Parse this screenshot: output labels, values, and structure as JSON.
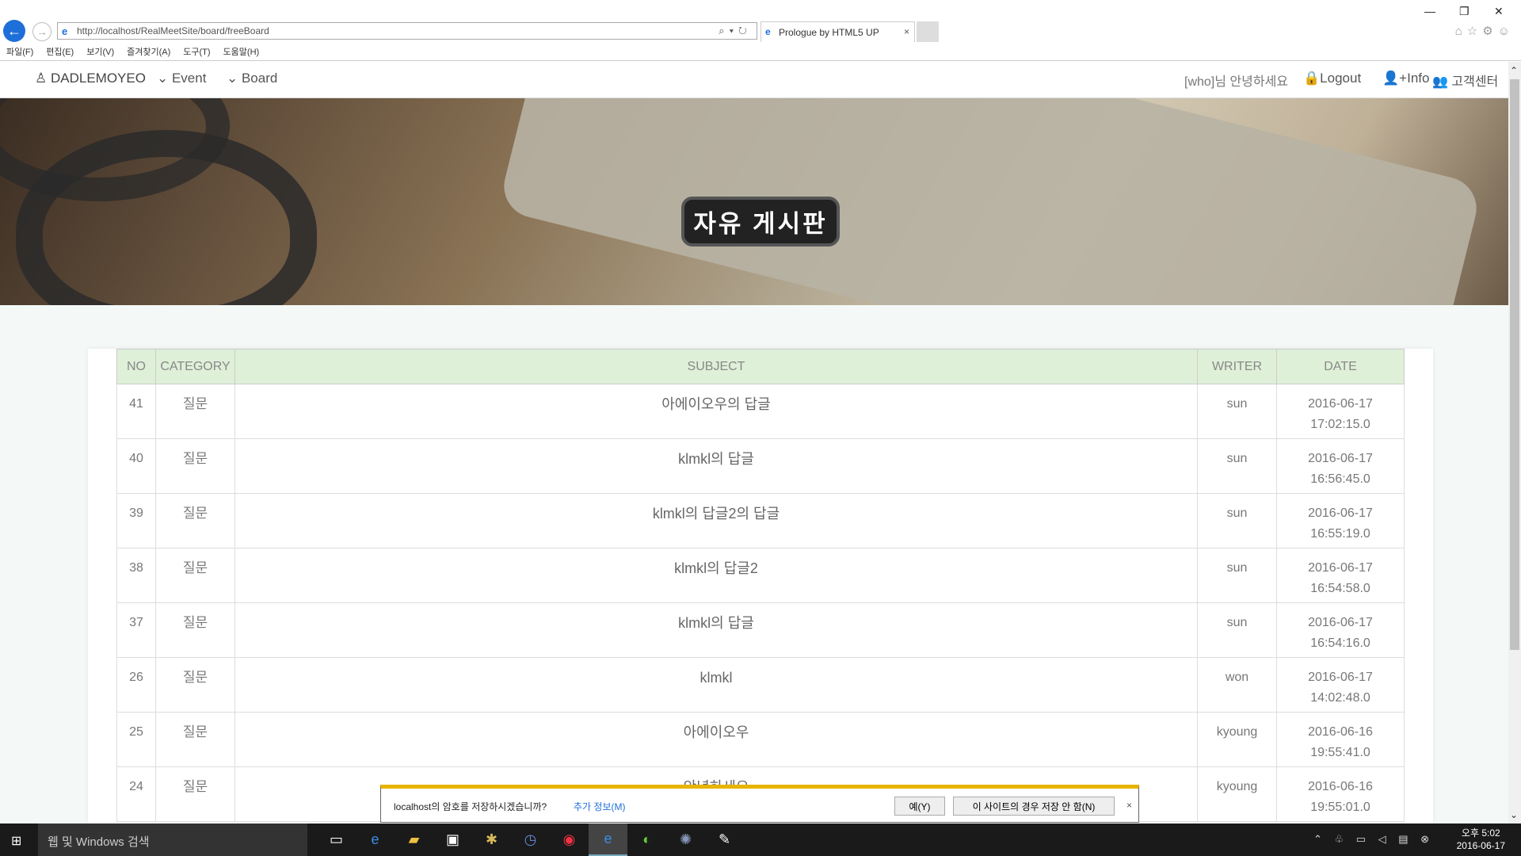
{
  "browser": {
    "url": "http://localhost/RealMeetSite/board/freeBoard",
    "tab_title": "Prologue by HTML5 UP",
    "menu": [
      "파일(F)",
      "편집(E)",
      "보기(V)",
      "즐겨찾기(A)",
      "도구(T)",
      "도움말(H)"
    ]
  },
  "sitenav": {
    "brand": "DADLEMOYEO",
    "event": "Event",
    "board": "Board",
    "greeting": "[who]님 안녕하세요",
    "logout": "Logout",
    "info": "Info",
    "support": "고객센터"
  },
  "hero": {
    "title": "자유 게시판"
  },
  "board": {
    "columns": [
      "NO",
      "CATEGORY",
      "SUBJECT",
      "WRITER",
      "DATE"
    ],
    "rows": [
      {
        "no": "41",
        "category": "질문",
        "subject": "아에이오우의 답글",
        "writer": "sun",
        "date": "2016-06-17",
        "time": "17:02:15.0"
      },
      {
        "no": "40",
        "category": "질문",
        "subject": "klmkl의 답글",
        "writer": "sun",
        "date": "2016-06-17",
        "time": "16:56:45.0"
      },
      {
        "no": "39",
        "category": "질문",
        "subject": "klmkl의 답글2의 답글",
        "writer": "sun",
        "date": "2016-06-17",
        "time": "16:55:19.0"
      },
      {
        "no": "38",
        "category": "질문",
        "subject": "klmkl의 답글2",
        "writer": "sun",
        "date": "2016-06-17",
        "time": "16:54:58.0"
      },
      {
        "no": "37",
        "category": "질문",
        "subject": "klmkl의 답글",
        "writer": "sun",
        "date": "2016-06-17",
        "time": "16:54:16.0"
      },
      {
        "no": "26",
        "category": "질문",
        "subject": "klmkl",
        "writer": "won",
        "date": "2016-06-17",
        "time": "14:02:48.0"
      },
      {
        "no": "25",
        "category": "질문",
        "subject": "아에이오우",
        "writer": "kyoung",
        "date": "2016-06-16",
        "time": "19:55:41.0"
      },
      {
        "no": "24",
        "category": "질문",
        "subject": "안녕하세요",
        "writer": "kyoung",
        "date": "2016-06-16",
        "time": "19:55:01.0"
      }
    ]
  },
  "notification": {
    "message": "localhost의 암호를 저장하시겠습니까?",
    "more": "추가 정보(M)",
    "yes": "예(Y)",
    "no": "이 사이트의 경우 저장 안 함(N)"
  },
  "taskbar": {
    "search": "웹 및 Windows 검색",
    "time": "오후 5:02",
    "date": "2016-06-17"
  }
}
